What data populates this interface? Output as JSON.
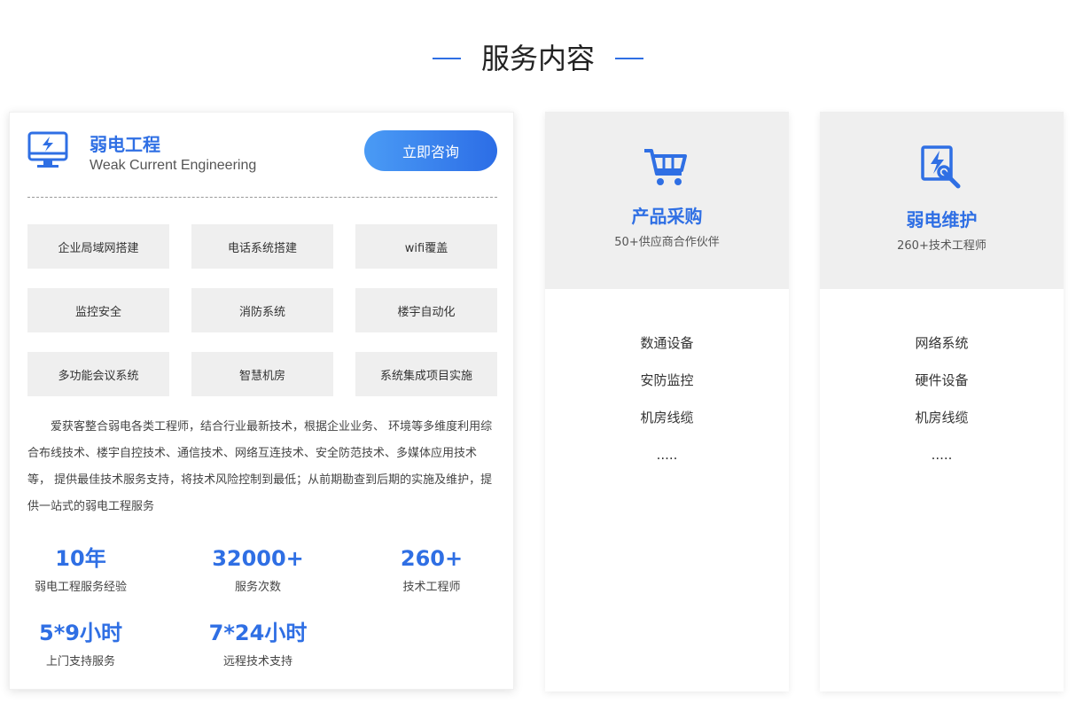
{
  "section": {
    "title": "服务内容"
  },
  "main_card": {
    "title": "弱电工程",
    "subtitle": "Weak Current Engineering",
    "consult_button": "立即咨询",
    "services": [
      "企业局域网搭建",
      "电话系统搭建",
      "wifi覆盖",
      "监控安全",
      "消防系统",
      "楼宇自动化",
      "多功能会议系统",
      "智慧机房",
      "系统集成项目实施"
    ],
    "description": "爱获客整合弱电各类工程师，结合行业最新技术，根据企业业务、 环境等多维度利用综合布线技术、楼宇自控技术、通信技术、网络互连技术、安全防范技术、多媒体应用技术等， 提供最佳技术服务支持，将技术风险控制到最低；从前期勘查到后期的实施及维护，提供一站式的弱电工程服务",
    "stats": [
      {
        "value": "10年",
        "label": "弱电工程服务经验"
      },
      {
        "value": "32000+",
        "label": "服务次数"
      },
      {
        "value": "260+",
        "label": "技术工程师"
      },
      {
        "value": "5*9小时",
        "label": "上门支持服务"
      },
      {
        "value": "7*24小时",
        "label": "远程技术支持"
      }
    ]
  },
  "product_card": {
    "title": "产品采购",
    "subtitle": "50+供应商合作伙伴",
    "items": [
      "数通设备",
      "安防监控",
      "机房线缆",
      "....."
    ]
  },
  "maintenance_card": {
    "title": "弱电维护",
    "subtitle": "260+技术工程师",
    "items": [
      "网络系统",
      "硬件设备",
      "机房线缆",
      "....."
    ]
  },
  "colors": {
    "accent": "#2f6fe4",
    "tile_bg": "#efefef",
    "button_gradient_start": "#4a9bf5",
    "button_gradient_end": "#2c6de6"
  },
  "icons": {
    "main": "monitor-bolt-icon",
    "product": "shopping-cart-icon",
    "maintenance": "repair-tools-icon"
  }
}
